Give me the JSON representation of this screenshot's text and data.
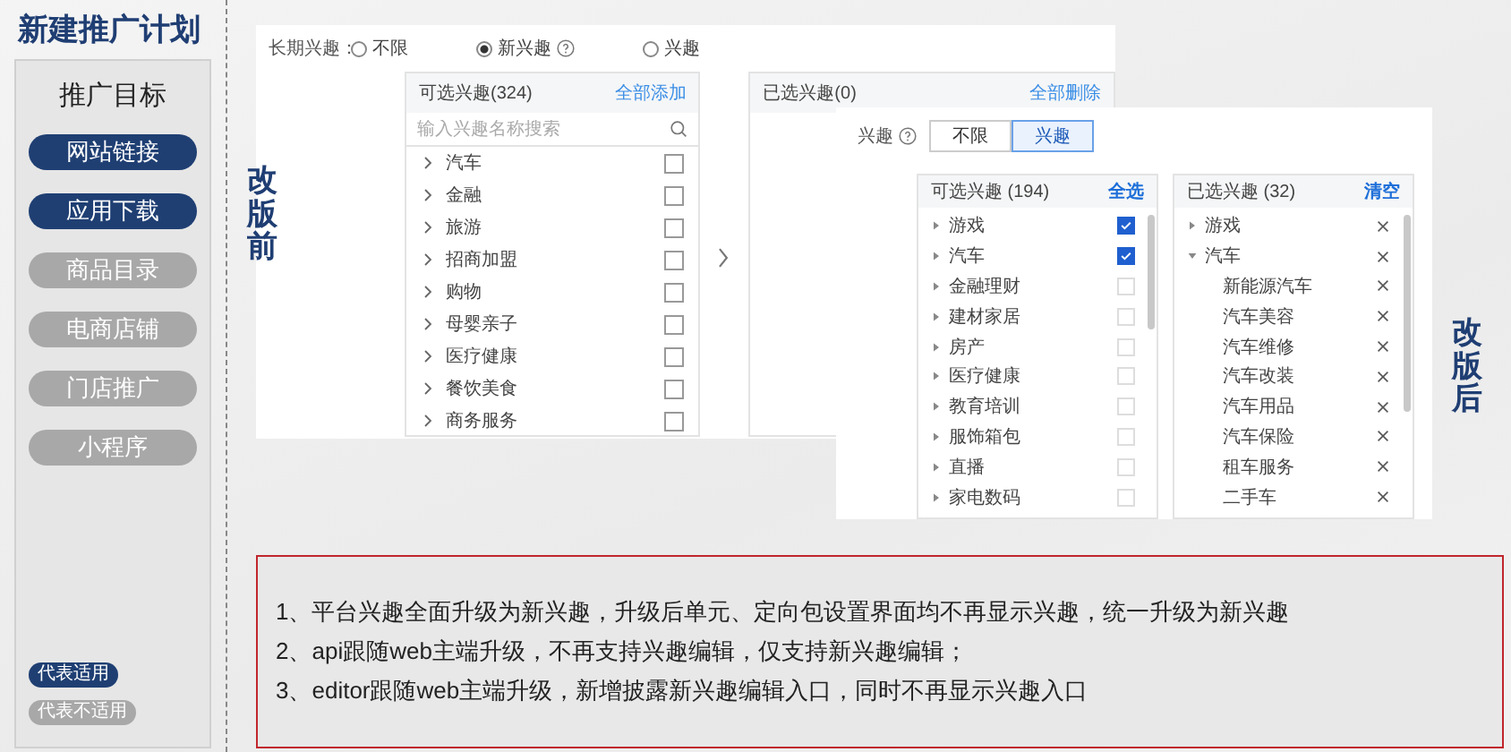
{
  "sidebar": {
    "title": "新建推广计划",
    "heading": "推广目标",
    "items": [
      {
        "label": "网站链接",
        "applicable": true
      },
      {
        "label": "应用下载",
        "applicable": true
      },
      {
        "label": "商品目录",
        "applicable": false
      },
      {
        "label": "电商店铺",
        "applicable": false
      },
      {
        "label": "门店推广",
        "applicable": false
      },
      {
        "label": "小程序",
        "applicable": false
      }
    ],
    "legend": [
      {
        "label": "代表适用",
        "applicable": true
      },
      {
        "label": "代表不适用",
        "applicable": false
      }
    ]
  },
  "before": {
    "tag": "改版前",
    "field_label": "长期兴趣：",
    "radios": [
      {
        "label": "不限",
        "selected": false,
        "help": false
      },
      {
        "label": "新兴趣",
        "selected": true,
        "help": true
      },
      {
        "label": "兴趣",
        "selected": false,
        "help": false
      }
    ],
    "available": {
      "title": "可选兴趣(324)",
      "action": "全部添加",
      "search": {
        "placeholder": "输入兴趣名称搜索"
      },
      "items": [
        {
          "label": "汽车",
          "checked": false
        },
        {
          "label": "金融",
          "checked": false
        },
        {
          "label": "旅游",
          "checked": false
        },
        {
          "label": "招商加盟",
          "checked": false
        },
        {
          "label": "购物",
          "checked": false
        },
        {
          "label": "母婴亲子",
          "checked": false
        },
        {
          "label": "医疗健康",
          "checked": false
        },
        {
          "label": "餐饮美食",
          "checked": false
        },
        {
          "label": "商务服务",
          "checked": false
        }
      ]
    },
    "chosen": {
      "title": "已选兴趣(0)",
      "action": "全部删除"
    }
  },
  "after": {
    "tag": "改版后",
    "field_label": "兴趣",
    "segments": [
      {
        "label": "不限",
        "selected": false
      },
      {
        "label": "兴趣",
        "selected": true
      }
    ],
    "available": {
      "title": "可选兴趣 (194)",
      "action": "全选",
      "items": [
        {
          "label": "游戏",
          "checked": true
        },
        {
          "label": "汽车",
          "checked": true
        },
        {
          "label": "金融理财",
          "checked": false
        },
        {
          "label": "建材家居",
          "checked": false
        },
        {
          "label": "房产",
          "checked": false
        },
        {
          "label": "医疗健康",
          "checked": false
        },
        {
          "label": "教育培训",
          "checked": false
        },
        {
          "label": "服饰箱包",
          "checked": false
        },
        {
          "label": "直播",
          "checked": false
        },
        {
          "label": "家电数码",
          "checked": false
        }
      ]
    },
    "chosen": {
      "title": "已选兴趣 (32)",
      "action": "清空",
      "items": [
        {
          "label": "游戏",
          "expanded": false
        },
        {
          "label": "汽车",
          "expanded": true,
          "children": [
            {
              "label": "新能源汽车"
            },
            {
              "label": "汽车美容"
            },
            {
              "label": "汽车维修"
            },
            {
              "label": "汽车改装"
            },
            {
              "label": "汽车用品"
            },
            {
              "label": "汽车保险"
            },
            {
              "label": "租车服务"
            },
            {
              "label": "二手车"
            }
          ]
        }
      ]
    }
  },
  "notes": [
    "1、平台兴趣全面升级为新兴趣，升级后单元、定向包设置界面均不再显示兴趣，统一升级为新兴趣",
    "2、api跟随web主端升级，不再支持兴趣编辑，仅支持新兴趣编辑；",
    "3、editor跟随web主端升级，新增披露新兴趣编辑入口，同时不再显示兴趣入口"
  ]
}
